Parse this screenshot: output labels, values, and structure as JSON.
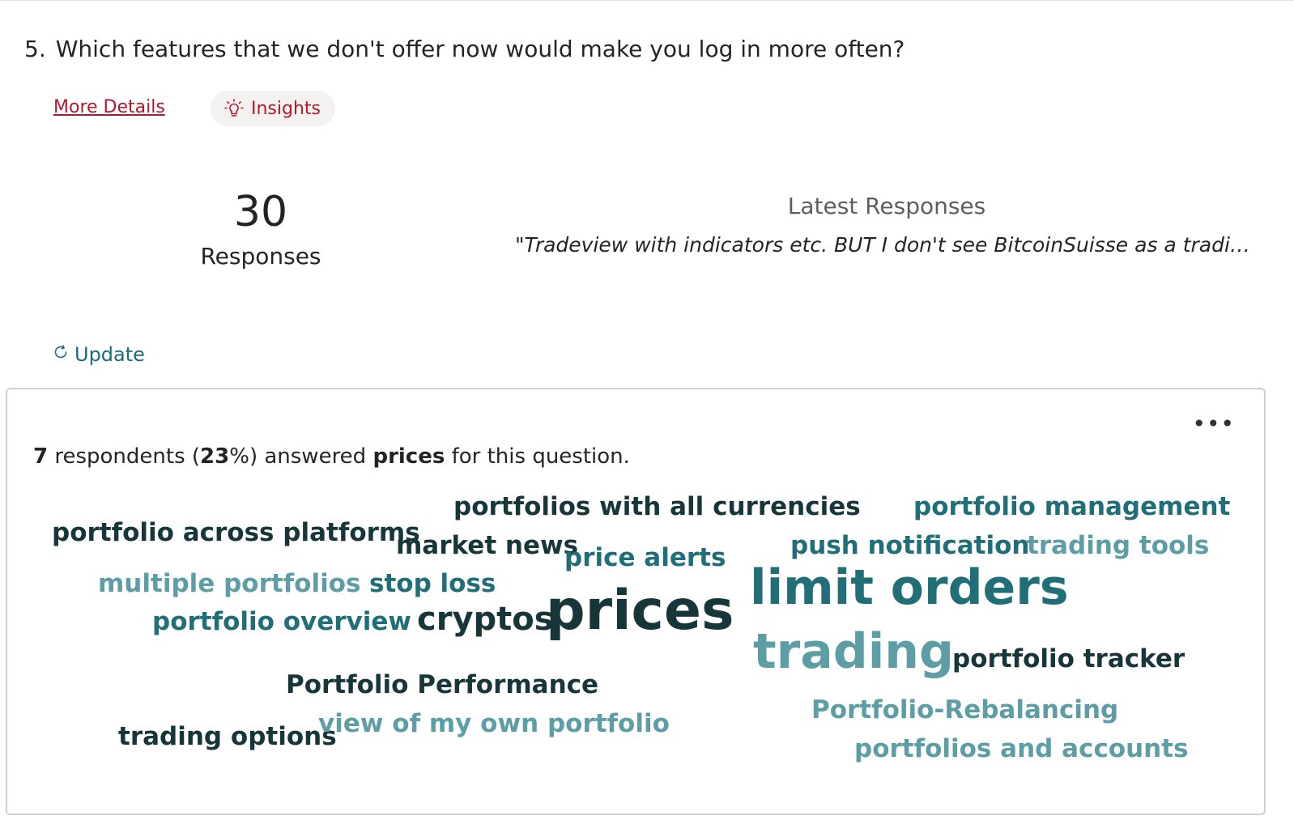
{
  "question": {
    "number": "5.",
    "text": "Which features that we don't offer now would make you log in more often?"
  },
  "links": {
    "more_details": "More Details",
    "insights": "Insights"
  },
  "stats": {
    "response_count": "30",
    "response_label": "Responses",
    "latest_title": "Latest Responses",
    "latest_quote": "\"Tradeview with indicators etc. BUT I don't see BitcoinSuisse as a trading pl..."
  },
  "update_label": "Update",
  "card": {
    "more_menu": "•••",
    "summary": {
      "count": "7",
      "text1": " respondents (",
      "percent": "23",
      "text2": "%) answered ",
      "keyword": "prices",
      "text3": " for this question."
    }
  },
  "word_cloud": {
    "colors": {
      "dark": "#17363a",
      "mid": "#1f6e78",
      "light": "#5d9ea6"
    },
    "words": [
      {
        "text": "portfolios with all currencies",
        "tone": "dark"
      },
      {
        "text": "portfolio management",
        "tone": "mid"
      },
      {
        "text": "portfolio across platforms",
        "tone": "dark"
      },
      {
        "text": "market news",
        "tone": "dark"
      },
      {
        "text": "price alerts",
        "tone": "mid"
      },
      {
        "text": "push notification",
        "tone": "mid"
      },
      {
        "text": "trading tools",
        "tone": "light"
      },
      {
        "text": "multiple portfolios",
        "tone": "light"
      },
      {
        "text": "stop loss",
        "tone": "mid"
      },
      {
        "text": "limit orders",
        "tone": "mid"
      },
      {
        "text": "portfolio overview",
        "tone": "mid"
      },
      {
        "text": "cryptos",
        "tone": "dark"
      },
      {
        "text": "prices",
        "tone": "dark"
      },
      {
        "text": "trading",
        "tone": "light"
      },
      {
        "text": "portfolio tracker",
        "tone": "dark"
      },
      {
        "text": "Portfolio Performance",
        "tone": "dark"
      },
      {
        "text": "Portfolio-Rebalancing",
        "tone": "light"
      },
      {
        "text": "trading options",
        "tone": "dark"
      },
      {
        "text": "view of my own portfolio",
        "tone": "light"
      },
      {
        "text": "portfolios and accounts",
        "tone": "light"
      }
    ]
  }
}
